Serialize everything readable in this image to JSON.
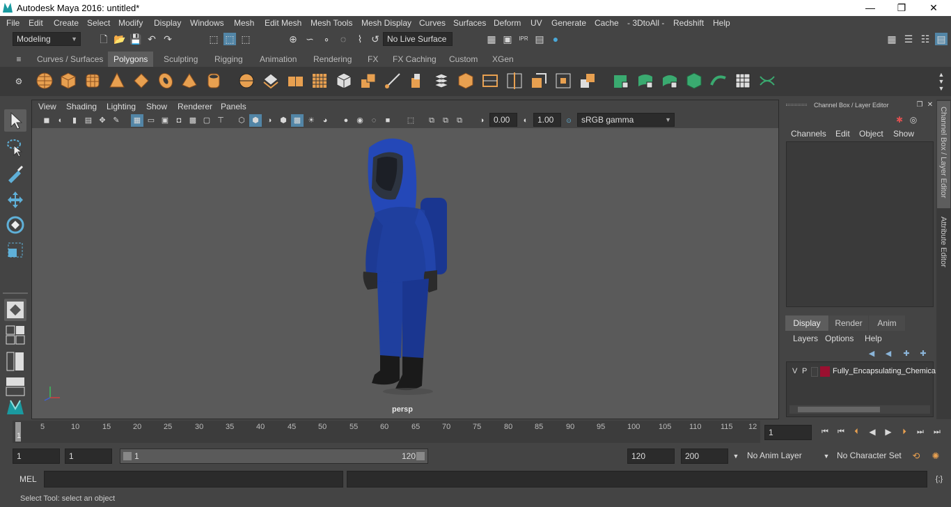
{
  "window": {
    "title": "Autodesk Maya 2016: untitled*",
    "minimize": "—",
    "maximize": "❐",
    "close": "✕"
  },
  "menubar": [
    "File",
    "Edit",
    "Create",
    "Select",
    "Modify",
    "Display",
    "Windows",
    "Mesh",
    "Edit Mesh",
    "Mesh Tools",
    "Mesh Display",
    "Curves",
    "Surfaces",
    "Deform",
    "UV",
    "Generate",
    "Cache",
    "- 3DtoAll -",
    "Redshift",
    "Help"
  ],
  "statusline": {
    "mode": "Modeling",
    "live_surface": "No Live Surface"
  },
  "shelf_tabs": [
    "Curves / Surfaces",
    "Polygons",
    "Sculpting",
    "Rigging",
    "Animation",
    "Rendering",
    "FX",
    "FX Caching",
    "Custom",
    "XGen"
  ],
  "active_shelf_tab": "Polygons",
  "viewport": {
    "menus": [
      "View",
      "Shading",
      "Lighting",
      "Show",
      "Renderer",
      "Panels"
    ],
    "exposure": "0.00",
    "gamma": "1.00",
    "colorspace": "sRGB gamma",
    "camera_label": "persp"
  },
  "channel_box": {
    "title": "Channel Box / Layer Editor",
    "menus": [
      "Channels",
      "Edit",
      "Object",
      "Show"
    ]
  },
  "layer_editor": {
    "tabs": [
      "Display",
      "Render",
      "Anim"
    ],
    "menus": [
      "Layers",
      "Options",
      "Help"
    ],
    "layer": {
      "v": "V",
      "p": "P",
      "name": "Fully_Encapsulating_Chemica",
      "color": "#9a1030"
    }
  },
  "side_tabs": [
    "Channel Box / Layer Editor",
    "Attribute Editor"
  ],
  "timeline": {
    "ticks": [
      "5",
      "10",
      "15",
      "20",
      "25",
      "30",
      "35",
      "40",
      "45",
      "50",
      "55",
      "60",
      "65",
      "70",
      "75",
      "80",
      "85",
      "90",
      "95",
      "100",
      "105",
      "110",
      "115",
      "12"
    ],
    "current_marker": "1",
    "current_frame": "1"
  },
  "range": {
    "start": "1",
    "playback_start": "1",
    "slider_start": "1",
    "slider_end": "120",
    "playback_end": "120",
    "end": "200",
    "anim_layer": "No Anim Layer",
    "character_set": "No Character Set"
  },
  "command_line": {
    "label": "MEL"
  },
  "help_line": {
    "text": "Select Tool: select an object"
  },
  "colors": {
    "accent": "#5285a6",
    "polygon_icon": "#e8a050",
    "suit": "#1f3f9e"
  }
}
